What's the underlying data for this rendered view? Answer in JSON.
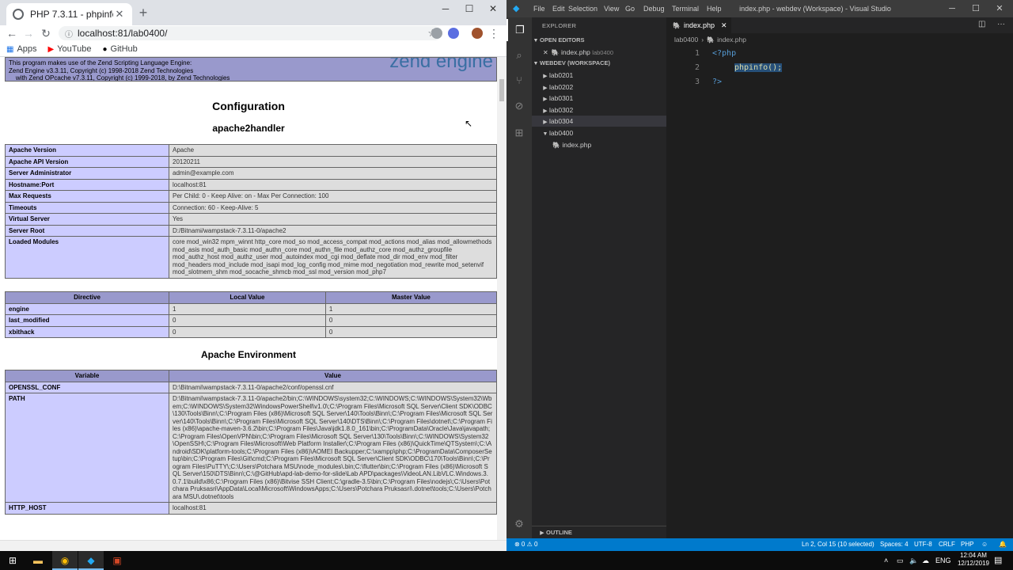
{
  "chrome": {
    "tab_title": "PHP 7.3.11 - phpinfo()",
    "url": "localhost:81/lab0400/",
    "bookmarks": [
      "Apps",
      "YouTube",
      "GitHub"
    ]
  },
  "phpinfo": {
    "zend_lines": [
      "This program makes use of the Zend Scripting Language Engine:",
      "Zend Engine v3.3.11, Copyright (c) 1998-2018 Zend Technologies",
      "    with Zend OPcache v7.3.11, Copyright (c) 1999-2018, by Zend Technologies"
    ],
    "zend_logo": "zend engine",
    "configuration_title": "Configuration",
    "apache_title": "apache2handler",
    "apache_rows": [
      [
        "Apache Version",
        "Apache"
      ],
      [
        "Apache API Version",
        "20120211"
      ],
      [
        "Server Administrator",
        "admin@example.com"
      ],
      [
        "Hostname:Port",
        "localhost:81"
      ],
      [
        "Max Requests",
        "Per Child: 0 - Keep Alive: on - Max Per Connection: 100"
      ],
      [
        "Timeouts",
        "Connection: 60 - Keep-Alive: 5"
      ],
      [
        "Virtual Server",
        "Yes"
      ],
      [
        "Server Root",
        "D:/Bitnami/wampstack-7.3.11-0/apache2"
      ],
      [
        "Loaded Modules",
        "core mod_win32 mpm_winnt http_core mod_so mod_access_compat mod_actions mod_alias mod_allowmethods mod_asis mod_auth_basic mod_authn_core mod_authn_file mod_authz_core mod_authz_groupfile mod_authz_host mod_authz_user mod_autoindex mod_cgi mod_deflate mod_dir mod_env mod_filter mod_headers mod_include mod_isapi mod_log_config mod_mime mod_negotiation mod_rewrite mod_setenvif mod_slotmem_shm mod_socache_shmcb mod_ssl mod_version mod_php7"
      ]
    ],
    "directive_headers": [
      "Directive",
      "Local Value",
      "Master Value"
    ],
    "directive_rows": [
      [
        "engine",
        "1",
        "1"
      ],
      [
        "last_modified",
        "0",
        "0"
      ],
      [
        "xbithack",
        "0",
        "0"
      ]
    ],
    "env_title": "Apache Environment",
    "env_headers": [
      "Variable",
      "Value"
    ],
    "env_rows": [
      [
        "OPENSSL_CONF",
        "D:\\Bitnami\\wampstack-7.3.11-0/apache2/conf/openssl.cnf"
      ],
      [
        "PATH",
        "D:\\Bitnami\\wampstack-7.3.11-0/apache2/bin;C:\\WINDOWS\\system32;C:\\WINDOWS;C:\\WINDOWS\\System32\\Wbem;C:\\WINDOWS\\System32\\WindowsPowerShell\\v1.0\\;C:\\Program Files\\Microsoft SQL Server\\Client SDK\\ODBC\\130\\Tools\\Binn\\;C:\\Program Files (x86)\\Microsoft SQL Server\\140\\Tools\\Binn\\;C:\\Program Files\\Microsoft SQL Server\\140\\Tools\\Binn\\;C:\\Program Files\\Microsoft SQL Server\\140\\DTS\\Binn\\;C:\\Program Files\\dotnet\\;C:\\Program Files (x86)\\apache-maven-3.6.2\\bin;C:\\Program Files\\Java\\jdk1.8.0_161\\bin;C:\\ProgramData\\Oracle\\Java\\javapath;C:\\Program Files\\OpenVPN\\bin;C:\\Program Files\\Microsoft SQL Server\\130\\Tools\\Binn\\;C:\\WINDOWS\\System32\\OpenSSH\\;C:\\Program Files\\Microsoft\\Web Platform Installer\\;C:\\Program Files (x86)\\QuickTime\\QTSystem\\;C:\\Android\\SDK\\platform-tools;C:\\Program Files (x86)\\AOMEI Backupper;C:\\xampp\\php;C:\\ProgramData\\ComposerSetup\\bin;C:\\Program Files\\Git\\cmd;C:\\Program Files\\Microsoft SQL Server\\Client SDK\\ODBC\\170\\Tools\\Binn\\;C:\\Program Files\\PuTTY\\;C:\\Users\\Potchara MSU\\node_modules\\.bin;C:\\flutter\\bin;C:\\Program Files (x86)\\Microsoft SQL Server\\150\\DTS\\Binn\\;C:\\@GitHub\\apd-lab-demo-for-slide\\Lab APD\\packages\\VideoLAN.LibVLC.Windows.3.0.7.1\\build\\x86;C:\\Program Files (x86)\\Bitvise SSH Client;C:\\gradle-3.5\\bin;C:\\Program Files\\nodejs\\;C:\\Users\\Potchara Pruksasri\\AppData\\Local\\Microsoft\\WindowsApps;C:\\Users\\Potchara Pruksasri\\.dotnet\\tools;C:\\Users\\Potchara MSU\\.dotnet\\tools"
      ],
      [
        "HTTP_HOST",
        "localhost:81"
      ]
    ]
  },
  "vscode": {
    "menu": [
      "File",
      "Edit",
      "Selection",
      "View",
      "Go",
      "Debug",
      "Terminal",
      "Help"
    ],
    "title": "index.php - webdev (Workspace) - Visual Studio Code",
    "explorer_title": "EXPLORER",
    "open_editors": "OPEN EDITORS",
    "open_file": "index.php",
    "open_file_dir": "lab0400",
    "workspace": "WEBDEV (WORKSPACE)",
    "folders": [
      "lab0201",
      "lab0202",
      "lab0301",
      "lab0302",
      "lab0304",
      "lab0400"
    ],
    "file": "index.php",
    "tab_name": "index.php",
    "breadcrumb": [
      "lab0400",
      "index.php"
    ],
    "line_numbers": [
      "1",
      "2",
      "3"
    ],
    "code": {
      "open_tag": "<?php",
      "call": "phpinfo();",
      "close_tag": "?>"
    },
    "outline": "OUTLINE",
    "status": {
      "problems": "⊗ 0  ⚠ 0",
      "position": "Ln 2, Col 15 (10 selected)",
      "spaces": "Spaces: 4",
      "encoding": "UTF-8",
      "eol": "CRLF",
      "language": "PHP"
    }
  },
  "taskbar": {
    "lang": "ENG",
    "time": "12:04 AM",
    "date": "12/12/2019"
  }
}
